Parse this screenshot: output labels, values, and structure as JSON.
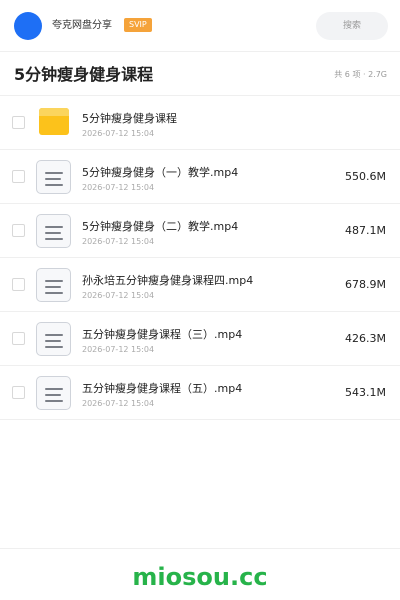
{
  "header": {
    "username": "夸克网盘分享",
    "badge": "SVIP",
    "search_placeholder": "搜索",
    "colors": {
      "avatar": "#1e6ff5",
      "badge": "#f5a33a"
    }
  },
  "folder": {
    "title": "5分钟瘦身健身课程",
    "summary": "共 6 项 · 2.7G"
  },
  "files": [
    {
      "icon": "folder-icon",
      "name": "5分钟瘦身健身课程",
      "date": "2026-07-12 15:04",
      "size": ""
    },
    {
      "icon": "file-icon",
      "name": "5分钟瘦身健身（一）教学.mp4",
      "date": "2026-07-12 15:04",
      "size": "550.6M"
    },
    {
      "icon": "file-icon",
      "name": "5分钟瘦身健身（二）教学.mp4",
      "date": "2026-07-12 15:04",
      "size": "487.1M"
    },
    {
      "icon": "file-icon",
      "name": "孙永培五分钟瘦身健身课程四.mp4",
      "date": "2026-07-12 15:04",
      "size": "678.9M"
    },
    {
      "icon": "file-icon",
      "name": "五分钟瘦身健身课程（三）.mp4",
      "date": "2026-07-12 15:04",
      "size": "426.3M"
    },
    {
      "icon": "file-icon",
      "name": "五分钟瘦身健身课程（五）.mp4",
      "date": "2026-07-12 15:04",
      "size": "543.1M"
    }
  ],
  "footer": {
    "watermark": "miosou.cc",
    "watermark_color": "#27b34a"
  }
}
